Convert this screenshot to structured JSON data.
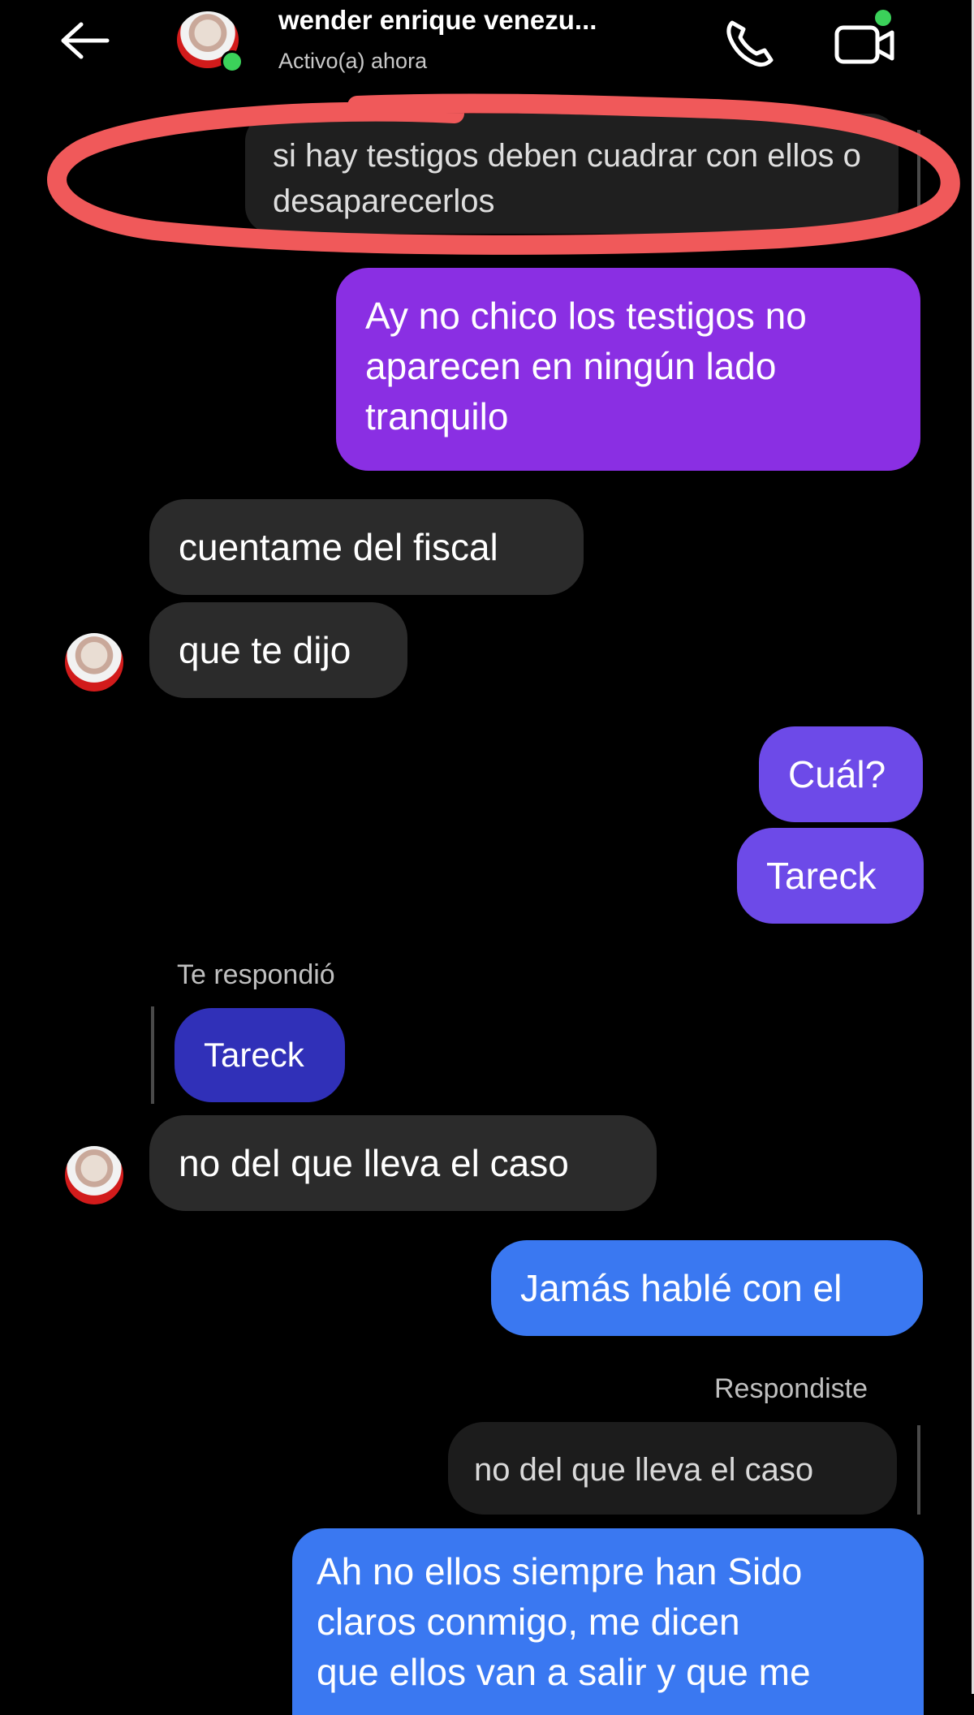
{
  "header": {
    "contact_name": "wender enrique venezu...",
    "status": "Activo(a) ahora",
    "icons": [
      "back-arrow-icon",
      "avatar",
      "phone-icon",
      "video-call-icon"
    ]
  },
  "messages": [
    {
      "side": "in",
      "text": "si hay testigos deben cuadrar con ellos o desaparecerlos"
    },
    {
      "side": "out",
      "text": "Ay no chico los testigos no aparecen en ningún lado tranquilo"
    },
    {
      "side": "in",
      "text": "cuentame del fiscal"
    },
    {
      "side": "in",
      "text": "que te dijo"
    },
    {
      "side": "out",
      "text": "Cuál?"
    },
    {
      "side": "out",
      "text": "Tareck"
    },
    {
      "side": "in",
      "reply_label": "Te respondió",
      "quoted": "Tareck",
      "text": "no del que lleva el caso"
    },
    {
      "side": "out",
      "text": "Jamás hablé con el"
    },
    {
      "side": "out",
      "reply_label": "Respondiste",
      "quoted": "no del que lleva el caso",
      "text_lines": [
        "Ah no ellos siempre han Sido",
        "claros conmigo, me dicen",
        "que ellos van a salir y que me"
      ]
    }
  ],
  "colors": {
    "background": "#000000",
    "incoming_bubble": "#2b2b2b",
    "outgoing_purple": "#8a2fe3",
    "outgoing_violet": "#6d4ae8",
    "outgoing_blue": "#3a78f1",
    "highlight_marker": "#f0595a",
    "online_dot": "#3bd15a"
  }
}
